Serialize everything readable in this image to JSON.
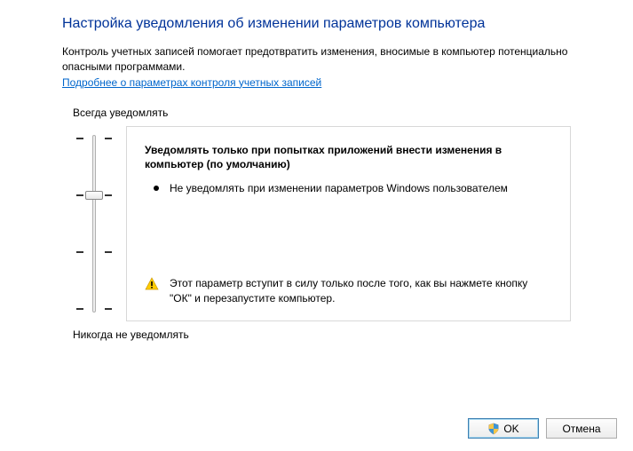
{
  "title": "Настройка уведомления об изменении параметров компьютера",
  "description": "Контроль учетных записей помогает предотвратить изменения, вносимые в компьютер потенциально опасными программами.",
  "link": "Подробнее о параметрах контроля учетных записей",
  "slider": {
    "top_label": "Всегда уведомлять",
    "bottom_label": "Никогда не уведомлять"
  },
  "info": {
    "heading": "Уведомлять только при попытках приложений внести изменения в компьютер (по умолчанию)",
    "bullet": "Не уведомлять при изменении параметров Windows пользователем",
    "warning": "Этот параметр вступит в силу только после того, как вы нажмете кнопку \"ОК\" и перезапустите компьютер."
  },
  "buttons": {
    "ok": "OK",
    "cancel": "Отмена"
  }
}
